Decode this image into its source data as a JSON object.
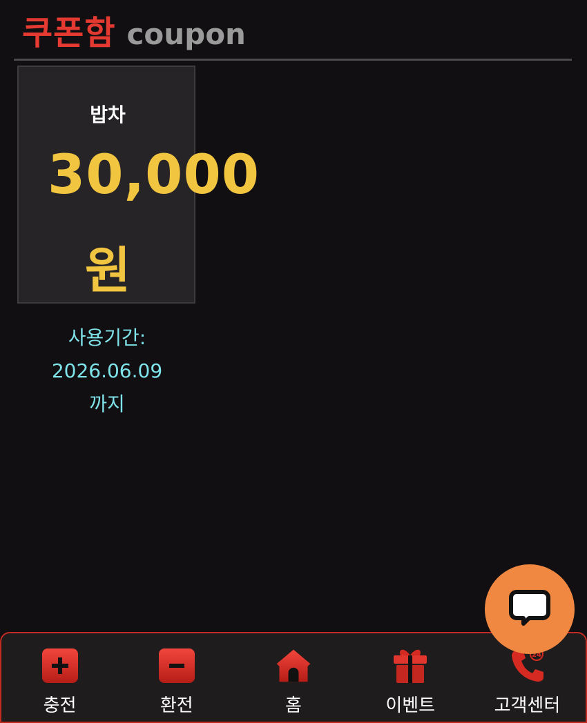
{
  "header": {
    "title_ko": "쿠폰함",
    "title_en": "coupon"
  },
  "coupon": {
    "name": "밥차",
    "amount": "30,000",
    "unit": "원",
    "validity_label": "사용기간:",
    "validity_date": "2026.06.09",
    "validity_suffix": "까지"
  },
  "nav": {
    "items": [
      {
        "label": "충전",
        "icon": "plus-box-icon"
      },
      {
        "label": "환전",
        "icon": "minus-box-icon"
      },
      {
        "label": "홈",
        "icon": "home-icon"
      },
      {
        "label": "이벤트",
        "icon": "gift-icon"
      },
      {
        "label": "고객센터",
        "icon": "phone-24-icon"
      }
    ]
  },
  "colors": {
    "background": "#110f11",
    "title_red": "#e53a31",
    "amount_yellow": "#f2c540",
    "validity_cyan": "#7fe3ea",
    "chat_orange": "#f08842",
    "nav_border": "#c22a22"
  }
}
